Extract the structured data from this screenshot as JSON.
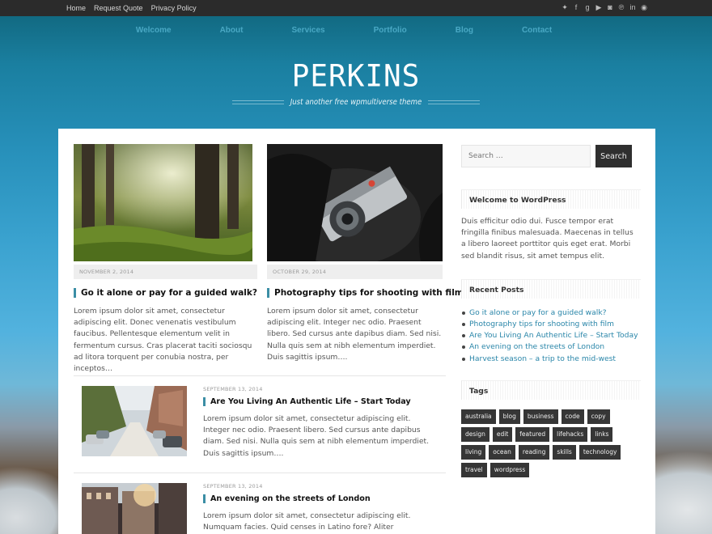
{
  "topbar": {
    "links": [
      "Home",
      "Request Quote",
      "Privacy Policy"
    ],
    "social_icons": [
      "twitter-icon",
      "facebook-icon",
      "google-plus-icon",
      "youtube-icon",
      "instagram-icon",
      "pinterest-icon",
      "linkedin-icon",
      "rss-icon"
    ]
  },
  "nav": [
    "Welcome",
    "About",
    "Services",
    "Portfolio",
    "Blog",
    "Contact"
  ],
  "site": {
    "title": "PERKINS",
    "tagline": "Just another free wpmultiverse theme"
  },
  "colors": {
    "accent": "#3b8ea5",
    "link": "#2a86a9",
    "dark": "#2f2f2f",
    "nav": "#49a8c4"
  },
  "posts_grid": [
    {
      "date": "NOVEMBER 2, 2014",
      "title": "Go it alone or pay for a guided walk?",
      "excerpt": "Lorem ipsum dolor sit amet, consectetur adipiscing elit. Donec venenatis vestibulum faucibus. Pellentesque elementum velit in fermentum cursus. Cras placerat taciti sociosqu ad litora torquent per conubia nostra, per inceptos…"
    },
    {
      "date": "OCTOBER 29, 2014",
      "title": "Photography tips for shooting with film",
      "excerpt": "Lorem ipsum dolor sit amet, consectetur adipiscing elit. Integer nec odio. Praesent libero. Sed cursus ante dapibus diam. Sed nisi. Nulla quis sem at nibh elementum imperdiet. Duis sagittis ipsum…."
    }
  ],
  "posts_list": [
    {
      "date": "SEPTEMBER 13, 2014",
      "title": "Are You Living An Authentic Life – Start Today",
      "excerpt": "Lorem ipsum dolor sit amet, consectetur adipiscing elit. Integer nec odio. Praesent libero. Sed cursus ante dapibus diam. Sed nisi. Nulla quis sem at nibh elementum imperdiet. Duis sagittis ipsum…."
    },
    {
      "date": "SEPTEMBER 13, 2014",
      "title": "An evening on the streets of London",
      "excerpt": "Lorem ipsum dolor sit amet, consectetur adipiscing elit. Numquam facies. Quid censes in Latino fore? Aliter homines, aliter"
    }
  ],
  "sidebar": {
    "search_placeholder": "Search …",
    "search_button": "Search",
    "welcome_title": "Welcome to WordPress",
    "welcome_text": "Duis efficitur odio dui. Fusce tempor erat fringilla finibus malesuada. Maecenas in tellus a libero laoreet porttitor quis eget erat. Morbi sed blandit risus, sit amet tempus elit.",
    "recent_title": "Recent Posts",
    "recent_posts": [
      "Go it alone or pay for a guided walk?",
      "Photography tips for shooting with film",
      "Are You Living An Authentic Life – Start Today",
      "An evening on the streets of London",
      "Harvest season – a trip to the mid-west"
    ],
    "tags_title": "Tags",
    "tags": [
      "australia",
      "blog",
      "business",
      "code",
      "copy",
      "design",
      "edit",
      "featured",
      "lifehacks",
      "links",
      "living",
      "ocean",
      "reading",
      "skills",
      "technology",
      "travel",
      "wordpress"
    ]
  }
}
